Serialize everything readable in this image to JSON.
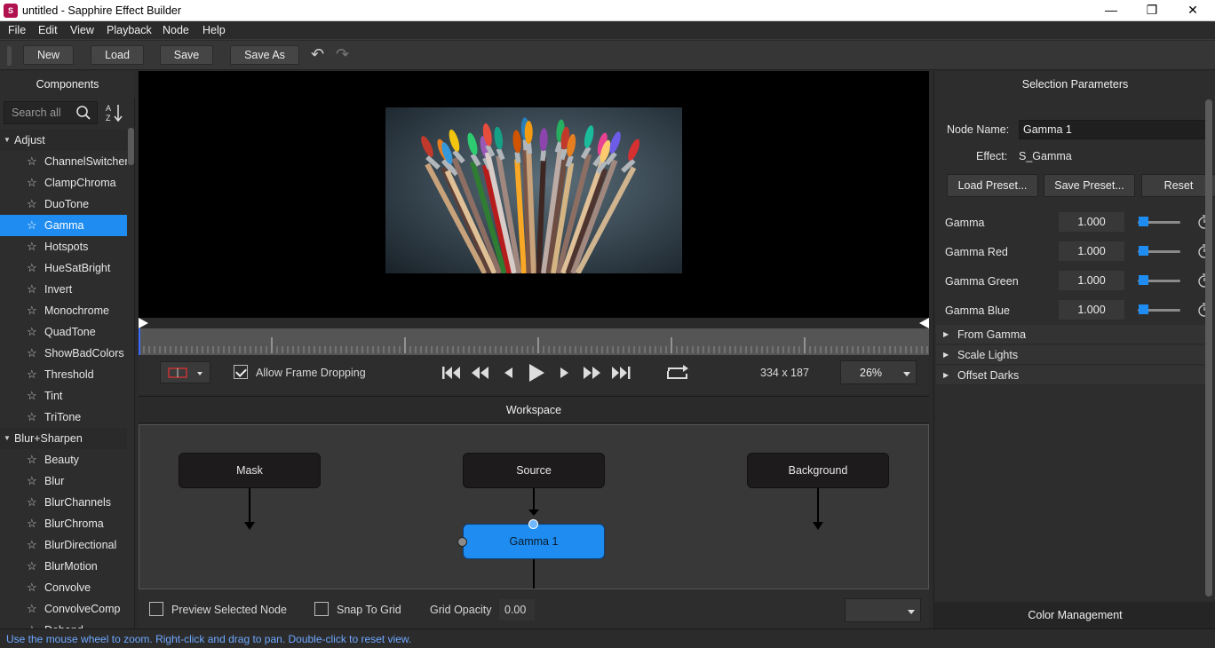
{
  "window": {
    "title": "untitled - Sapphire Effect Builder",
    "app_icon_letter": "S",
    "minimize": "—",
    "restore": "❐",
    "close": "✕"
  },
  "menu": [
    "File",
    "Edit",
    "View",
    "Playback",
    "Node",
    "Help"
  ],
  "toolbar": {
    "new_label": "New",
    "load_label": "Load",
    "save_label": "Save",
    "save_as_label": "Save As",
    "undo_icon": "↶",
    "redo_icon": "↷"
  },
  "components": {
    "header": "Components",
    "search_placeholder": "Search all",
    "categories": [
      {
        "name": "Adjust",
        "items": [
          "ChannelSwitcher",
          "ClampChroma",
          "DuoTone",
          "Gamma",
          "Hotspots",
          "HueSatBright",
          "Invert",
          "Monochrome",
          "QuadTone",
          "ShowBadColors",
          "Threshold",
          "Tint",
          "TriTone"
        ]
      },
      {
        "name": "Blur+Sharpen",
        "items": [
          "Beauty",
          "Blur",
          "BlurChannels",
          "BlurChroma",
          "BlurDirectional",
          "BlurMotion",
          "Convolve",
          "ConvolveComp",
          "Deband"
        ]
      }
    ],
    "selected_item": "Gamma"
  },
  "viewer": {
    "allow_frame_dropping_label": "Allow Frame Dropping",
    "allow_frame_dropping": true,
    "resolution": "334 x 187",
    "zoom": "26%"
  },
  "workspace": {
    "header": "Workspace",
    "nodes": {
      "mask": "Mask",
      "source": "Source",
      "background": "Background",
      "gamma": "Gamma 1"
    },
    "preview_selected_label": "Preview Selected Node",
    "snap_to_grid_label": "Snap To Grid",
    "grid_opacity_label": "Grid Opacity",
    "grid_opacity_value": "0.00"
  },
  "selection_parameters": {
    "header": "Selection Parameters",
    "node_name_label": "Node Name:",
    "node_name_value": "Gamma 1",
    "effect_label": "Effect:",
    "effect_value": "S_Gamma",
    "load_preset_label": "Load Preset...",
    "save_preset_label": "Save Preset...",
    "reset_label": "Reset",
    "params": [
      {
        "name": "Gamma",
        "value": "1.000"
      },
      {
        "name": "Gamma Red",
        "value": "1.000"
      },
      {
        "name": "Gamma Green",
        "value": "1.000"
      },
      {
        "name": "Gamma Blue",
        "value": "1.000"
      }
    ],
    "groups": [
      "From Gamma",
      "Scale Lights",
      "Offset Darks"
    ],
    "color_management": "Color Management"
  },
  "status": "Use the mouse wheel to zoom.  Right-click and drag to pan. Double-click to reset view.",
  "colors": {
    "accent": "#1e8cf0",
    "background": "#2b2b2b",
    "status_text": "#6fa8ff"
  }
}
